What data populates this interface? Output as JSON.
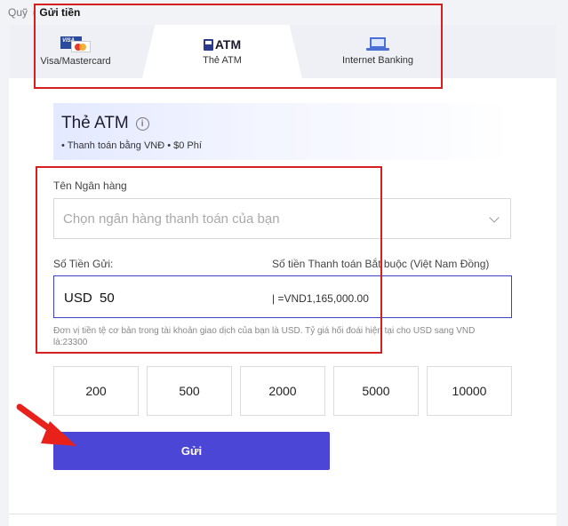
{
  "breadcrumb": {
    "parent": "Quỹ",
    "separator": "›",
    "current": "Gửi tiền"
  },
  "tabs": {
    "visa": {
      "label": "Visa/Mastercard",
      "card_text": "VISA"
    },
    "atm": {
      "title": "ATM",
      "label": "Thẻ ATM"
    },
    "internet_banking": {
      "label": "Internet Banking"
    }
  },
  "info": {
    "title": "Thẻ ATM",
    "info_icon": "i",
    "note": "• Thanh toán bằng VNĐ • $0 Phí"
  },
  "form": {
    "bank_label": "Tên Ngân hàng",
    "bank_placeholder": "Chọn ngân hàng thanh toán của bạn",
    "amount_label": "Số Tiền Gửi:",
    "required_label": "Số tiền Thanh toán Bắt buộc (Việt Nam Đồng)",
    "currency": "USD",
    "amount_value": "50",
    "converted": "| =VND1,165,000.00",
    "rate_note": "Đơn vị tiền tệ cơ bản trong tài khoản giao dịch của bạn là USD. Tỷ giá hối đoái hiện tại cho USD sang VND là:23300"
  },
  "presets": [
    "200",
    "500",
    "2000",
    "5000",
    "10000"
  ],
  "submit_label": "Gửi",
  "colors": {
    "accent": "#4b46d6",
    "highlight_box": "#d61f1f",
    "annotation_arrow": "#e8211b"
  },
  "icons": [
    "visa-mastercard-icon",
    "atm-card-icon",
    "laptop-bank-icon",
    "info-icon",
    "chevron-down-icon",
    "annotation-arrow-icon"
  ]
}
